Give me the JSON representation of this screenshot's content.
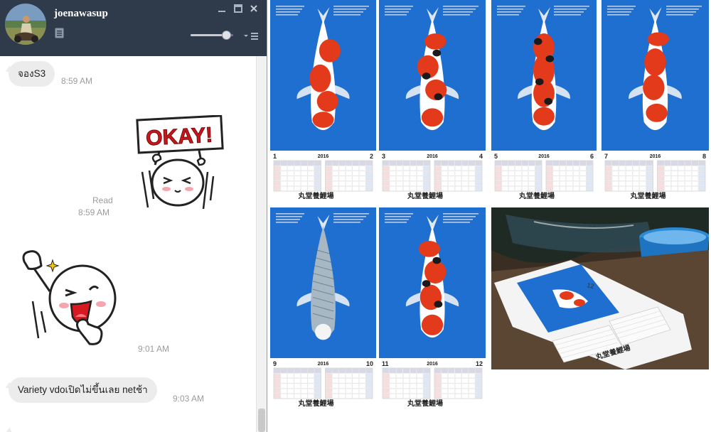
{
  "window": {
    "contact_name": "joenawasup"
  },
  "messages": [
    {
      "id": "m1",
      "side": "received",
      "type": "text",
      "text": "จองS3",
      "time": "8:59 AM"
    },
    {
      "id": "m2",
      "side": "sent",
      "type": "sticker",
      "sticker_text": "OKAY!",
      "status": "Read",
      "time": "8:59 AM"
    },
    {
      "id": "m3",
      "side": "received",
      "type": "sticker",
      "time": "9:01 AM"
    },
    {
      "id": "m4",
      "side": "received",
      "type": "text",
      "text": "Variety vdoเปิดไม่ขึ้นเลย netช้า",
      "time": "9:03 AM"
    }
  ],
  "volume": {
    "level": 0.85
  },
  "gallery": {
    "calendar_tiles": [
      {
        "month_left": "1",
        "month_right": "2",
        "year": "2016",
        "variety": "kohaku",
        "caption": "丸堂養鯉場"
      },
      {
        "month_left": "3",
        "month_right": "4",
        "year": "2016",
        "variety": "sanke",
        "caption": "丸堂養鯉場"
      },
      {
        "month_left": "5",
        "month_right": "6",
        "year": "2016",
        "variety": "showa",
        "caption": "丸堂養鯉場"
      },
      {
        "month_left": "7",
        "month_right": "8",
        "year": "2016",
        "variety": "kohaku2",
        "caption": "丸堂養鯉場"
      },
      {
        "month_left": "9",
        "month_right": "10",
        "year": "2016",
        "variety": "asagi",
        "caption": "丸堂養鯉場"
      },
      {
        "month_left": "11",
        "month_right": "12",
        "year": "2016",
        "variety": "sanke2",
        "caption": "丸堂養鯉場"
      }
    ],
    "photo_tile": {
      "month": "12",
      "caption": "丸堂養鯉場"
    }
  },
  "colors": {
    "header_bg": "#2f3a4b",
    "calendar_blue": "#1e6fd0",
    "koi_red": "#e23a1b",
    "bubble_bg": "#ececec"
  }
}
